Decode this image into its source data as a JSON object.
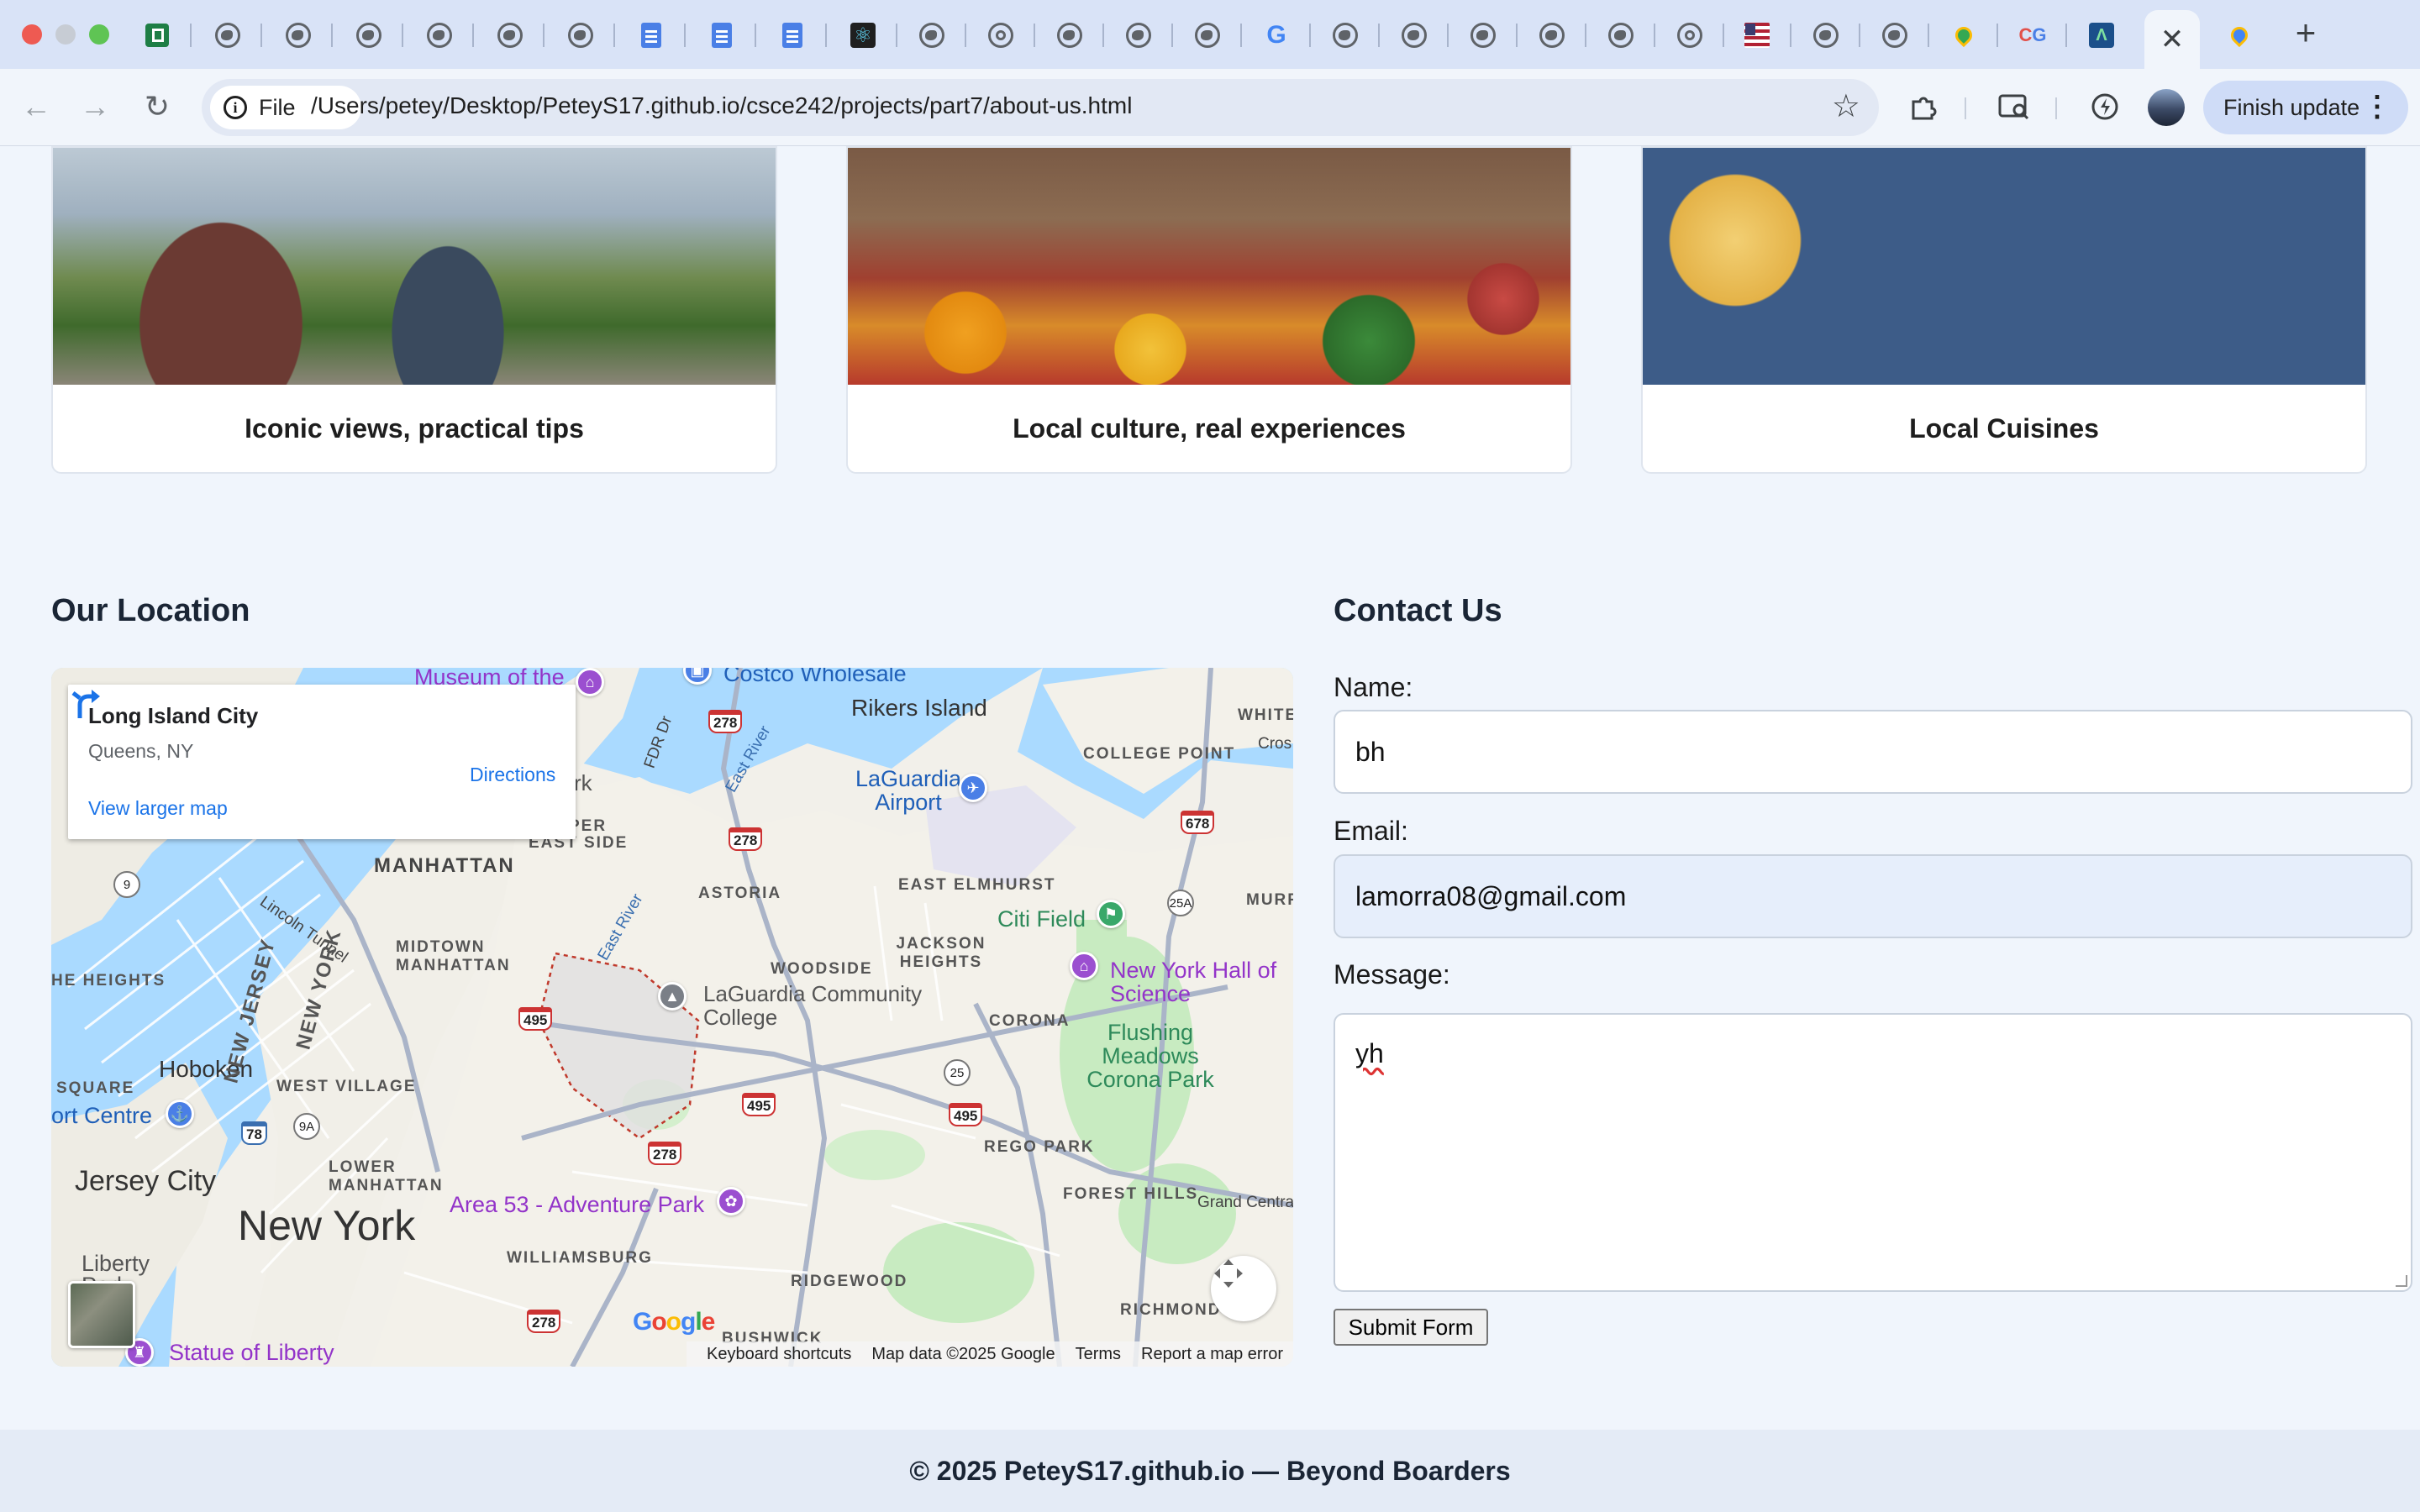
{
  "browser": {
    "url": "/Users/petey/Desktop/PeteyS17.github.io/csce242/projects/part7/about-us.html",
    "protocol_chip": "File",
    "finish_update_label": "Finish update",
    "tab_icons": [
      "sheets-icon",
      "globe-icon",
      "globe-icon",
      "globe-icon",
      "globe-icon",
      "globe-icon",
      "globe-icon",
      "docs-icon",
      "docs-icon",
      "docs-icon",
      "react-icon",
      "globe-icon",
      "chrome-icon",
      "globe-icon",
      "globe-icon",
      "globe-icon",
      "google-icon",
      "globe-icon",
      "globe-icon",
      "globe-icon",
      "globe-icon",
      "chrome-icon",
      "flag-icon",
      "globe-icon",
      "globe-icon",
      "maps-icon",
      "cg-icon",
      "app-icon",
      "close-icon",
      "maps-icon"
    ]
  },
  "cards": [
    {
      "title": "Iconic views, practical tips"
    },
    {
      "title": "Local culture, real experiences"
    },
    {
      "title": "Local Cuisines"
    }
  ],
  "location": {
    "heading": "Our Location",
    "map": {
      "place_name": "Long Island City",
      "place_sub": "Queens, NY",
      "directions": "Directions",
      "larger_map": "View larger map",
      "labels": {
        "new_york": "New York",
        "jersey_city": "Jersey City",
        "hoboken": "Hoboken",
        "manhattan": "MANHATTAN",
        "midtown": "MIDTOWN MANHATTAN",
        "east_side": "EAST SIDE",
        "west_village": "WEST VILLAGE",
        "lower_manhattan": "LOWER MANHATTAN",
        "heights_w": "HE HEIGHTS",
        "square": "SQUARE",
        "astoria": "ASTORIA",
        "woodside": "WOODSIDE",
        "jackson_heights": "JACKSON HEIGHTS",
        "east_elmhurst": "EAST ELMHURST",
        "college_point": "COLLEGE POINT",
        "white": "WHITE",
        "murr": "MURR",
        "corona": "CORONA",
        "rego_park": "REGO PARK",
        "forest_hills": "FOREST HILLS",
        "williamsburg": "WILLIAMSBURG",
        "ridgewood": "RIDGEWOOD",
        "bushwick": "BUSHWICK",
        "richmond": "RICHMOND",
        "rikers": "Rikers Island",
        "laguardia": "LaGuardia Airport",
        "citi_field": "Citi Field",
        "hall_science": "New York Hall of Science",
        "flushing": "Flushing Meadows Corona Park",
        "lagcc": "LaGuardia Community College",
        "area53": "Area 53 - Adventure Park",
        "museum": "Museum of the",
        "costco": "Costco Wholesale",
        "statue": "Statue of Liberty",
        "liberty_park": "Liberty Park",
        "port_centre": "ort Centre",
        "grand_central": "Grand Centra",
        "lincoln_tunnel": "Lincoln Tunnel",
        "fdr": "FDR Dr",
        "east_river": "East River",
        "new_jersey": "NEW JERSEY",
        "new_york_state": "NEW YORK",
        "cros": "Cros",
        "rk": "rk",
        "per": "PER"
      },
      "shields": [
        "278",
        "278",
        "278",
        "495",
        "495",
        "495",
        "278",
        "678",
        "25A",
        "25",
        "9",
        "9A",
        "78"
      ],
      "google": "Google",
      "footer": {
        "shortcuts": "Keyboard shortcuts",
        "map_data": "Map data ©2025 Google",
        "terms": "Terms",
        "report": "Report a map error"
      }
    }
  },
  "contact": {
    "heading": "Contact Us",
    "name_label": "Name:",
    "name_value": "bh",
    "email_label": "Email:",
    "email_value": "lamorra08@gmail.com",
    "message_label": "Message:",
    "message_value": "yh",
    "submit_label": "Submit Form"
  },
  "footer": {
    "text": "© 2025 PeteyS17.github.io — Beyond Boarders"
  }
}
